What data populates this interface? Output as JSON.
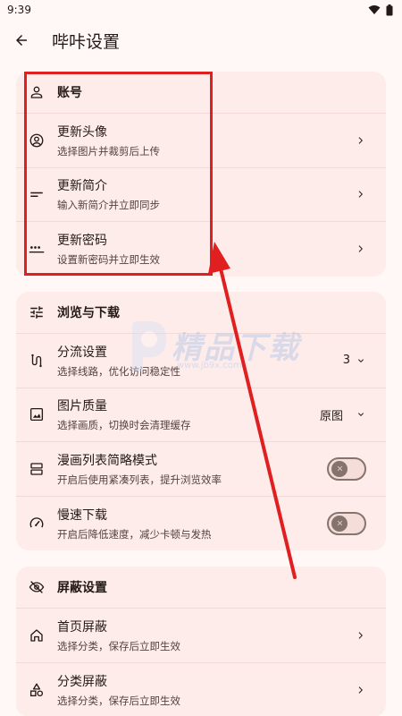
{
  "status_bar": {
    "time": "9:39"
  },
  "app_bar": {
    "title": "哔咔设置"
  },
  "account": {
    "header": "账号",
    "items": [
      {
        "title": "更新头像",
        "subtitle": "选择图片并裁剪后上传"
      },
      {
        "title": "更新简介",
        "subtitle": "输入新简介并立即同步"
      },
      {
        "title": "更新密码",
        "subtitle": "设置新密码并立即生效"
      }
    ]
  },
  "browse": {
    "header": "浏览与下载",
    "items": [
      {
        "title": "分流设置",
        "subtitle": "选择线路，优化访问稳定性",
        "value": "3"
      },
      {
        "title": "图片质量",
        "subtitle": "选择画质，切换时会清理缓存",
        "value": "原图"
      },
      {
        "title": "漫画列表简略模式",
        "subtitle": "开启后使用紧凑列表，提升浏览效率",
        "enabled": false
      },
      {
        "title": "慢速下载",
        "subtitle": "开启后降低速度，减少卡顿与发热",
        "enabled": false
      }
    ]
  },
  "block": {
    "header": "屏蔽设置",
    "items": [
      {
        "title": "首页屏蔽",
        "subtitle": "选择分类，保存后立即生效"
      },
      {
        "title": "分类屏蔽",
        "subtitle": "选择分类，保存后立即生效"
      }
    ]
  },
  "watermark": {
    "text": "精品下载",
    "url": "www.jb9x.com"
  },
  "colors": {
    "background": "#fff8f6",
    "card": "#fdecea",
    "annotation": "#e02020"
  }
}
